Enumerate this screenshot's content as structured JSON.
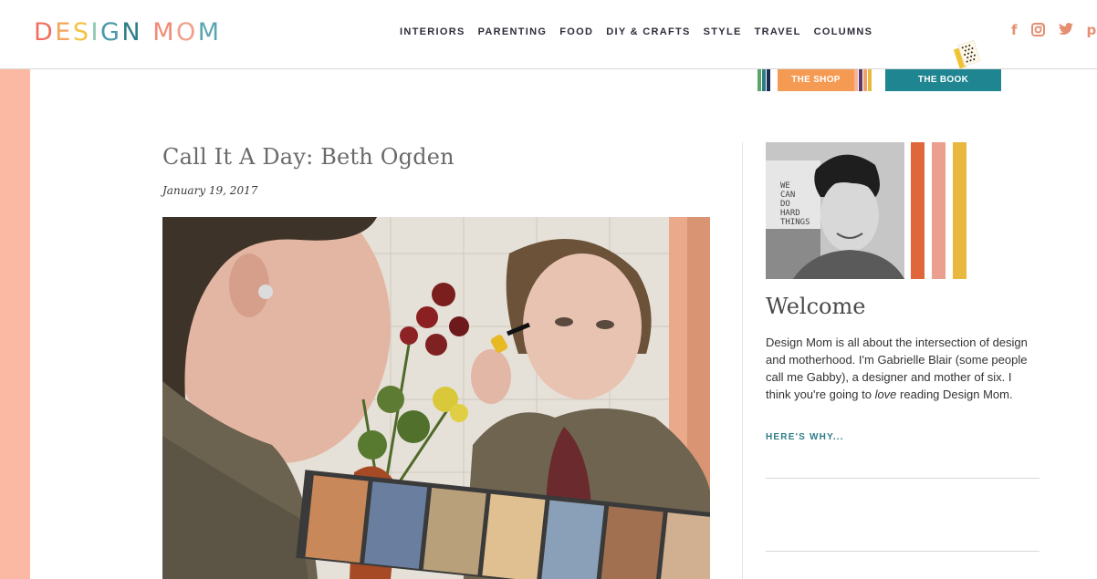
{
  "header": {
    "logo_letters": [
      {
        "ch": "D",
        "color": "#ef6f5e"
      },
      {
        "ch": "E",
        "color": "#f2a65a"
      },
      {
        "ch": "S",
        "color": "#f4c244"
      },
      {
        "ch": "I",
        "color": "#8cc7b1"
      },
      {
        "ch": "G",
        "color": "#4a9aa8"
      },
      {
        "ch": "N",
        "color": "#2f7d8a"
      },
      {
        "ch": " ",
        "color": "#ffffff"
      },
      {
        "ch": "M",
        "color": "#ef8b73"
      },
      {
        "ch": "O",
        "color": "#f0a08b"
      },
      {
        "ch": "M",
        "color": "#5aa6b0"
      }
    ],
    "nav": [
      "INTERIORS",
      "PARENTING",
      "FOOD",
      "DIY & CRAFTS",
      "STYLE",
      "TRAVEL",
      "COLUMNS"
    ],
    "social": [
      "facebook-icon",
      "instagram-icon",
      "twitter-icon",
      "pinterest-icon"
    ]
  },
  "shopbar": {
    "shop_label": "THE SHOP",
    "book_label": "THE BOOK",
    "shop_color": "#f59a52",
    "book_color": "#1f8591"
  },
  "post": {
    "title": "Call It A Day: Beth Ogden",
    "date": "January 19, 2017"
  },
  "sidebar": {
    "welcome_heading": "Welcome",
    "welcome_text_1": "Design Mom is all about the intersection of design and motherhood. I'm Gabrielle Blair (some people call me Gabby), a designer and mother of six. I think you're going to ",
    "welcome_text_em": "love",
    "welcome_text_2": " reading Design Mom.",
    "heres_why": "HERE'S WHY...",
    "portrait_sign": "WE CAN DO HARD THINGS",
    "stripe_colors": [
      "#e0663c",
      "#eba08f",
      "#e9b83e"
    ]
  },
  "colors": {
    "left_stripe": "#fbb9a4",
    "accent_teal": "#2e7c88",
    "social": "#e58f72"
  }
}
